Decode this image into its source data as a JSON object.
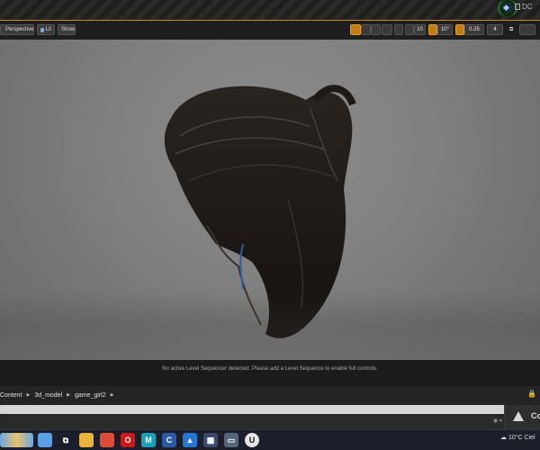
{
  "topbar": {
    "source_label": "DC"
  },
  "viewport": {
    "view_mode_label": "Perspective",
    "lighting_label": "Lit",
    "show_label": "Show",
    "grid_snap_value": "10",
    "rotation_snap_value": "10°",
    "scale_snap_value": "0.25",
    "camera_speed_value": "4",
    "status_message": "No active Level Sequencer detected. Please add a Level Sequence to enable full controls."
  },
  "content_browser": {
    "breadcrumb": [
      "Content",
      "3d_model",
      "game_girl2"
    ],
    "warning_label": "Co"
  },
  "taskbar": {
    "apps": [
      {
        "name": "start-app",
        "color": "#5aa0e6",
        "glyph": ""
      },
      {
        "name": "task-view",
        "color": "#1c1f2a",
        "glyph": "⧉"
      },
      {
        "name": "file-explorer",
        "color": "#e8b43a",
        "glyph": ""
      },
      {
        "name": "chrome",
        "color": "#dd4b39",
        "glyph": ""
      },
      {
        "name": "opera",
        "color": "#cc1a1a",
        "glyph": "O"
      },
      {
        "name": "maya",
        "color": "#1aa0b8",
        "glyph": "M"
      },
      {
        "name": "cinema4d",
        "color": "#2b5aa8",
        "glyph": "C"
      },
      {
        "name": "photos",
        "color": "#2676d4",
        "glyph": "▲"
      },
      {
        "name": "calculator",
        "color": "#3a4a6a",
        "glyph": "▦"
      },
      {
        "name": "app-generic",
        "color": "#55657a",
        "glyph": "▭"
      },
      {
        "name": "unreal-engine",
        "color": "#e6e6e6",
        "glyph": "U"
      }
    ],
    "weather_text": "10°C",
    "weather_desc": "Ciel"
  }
}
